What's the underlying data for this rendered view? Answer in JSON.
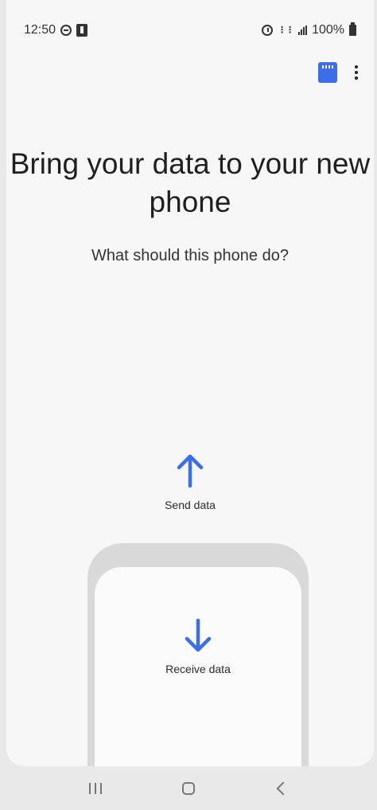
{
  "status_bar": {
    "time": "12:50",
    "battery": "100%"
  },
  "title": "Bring your data to your new phone",
  "subtitle": "What should this phone do?",
  "options": {
    "send_label": "Send data",
    "receive_label": "Receive data"
  },
  "colors": {
    "accent": "#3d6ee8"
  },
  "icons": {
    "sd_card": "sd-card-icon",
    "more": "more-vert-icon",
    "send": "arrow-up-icon",
    "receive": "arrow-down-icon",
    "recents": "recents-icon",
    "home": "home-icon",
    "back": "back-icon"
  }
}
